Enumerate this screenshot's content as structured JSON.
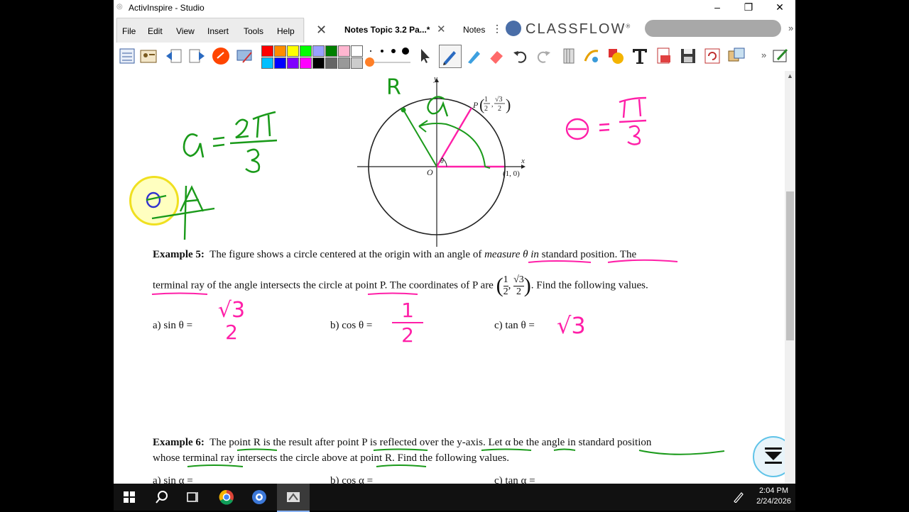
{
  "window": {
    "title": "ActivInspire - Studio"
  },
  "menu": {
    "file": "File",
    "edit": "Edit",
    "view": "View",
    "insert": "Insert",
    "tools": "Tools",
    "help": "Help"
  },
  "tabs": [
    {
      "label": "Notes Topic 3.2 Pa...*"
    },
    {
      "label": "Notes"
    }
  ],
  "classflow": {
    "brand": "CLASSFLOW",
    "mark": "®"
  },
  "palette": {
    "colors": [
      "#ff0000",
      "#ff8c00",
      "#ffff00",
      "#00ff00",
      "#008000",
      "#ffc0cb",
      "#ff80c0",
      "#ffffff",
      "#00bfff",
      "#0000ff",
      "#8000ff",
      "#ff00ff",
      "#000000",
      "#666666",
      "#999999",
      "#cccccc"
    ]
  },
  "page": {
    "top_handwriting": {
      "alpha_eq": "α = 2π/3",
      "theta_eq": "θ = π/3",
      "letter_r": "R"
    },
    "diagram": {
      "axis_y": "y",
      "axis_x": "x",
      "origin": "O",
      "point_p_label": "P",
      "point_p_x": "1",
      "point_p_x_den": "2",
      "point_p_y": "√3",
      "point_p_y_den": "2",
      "point_one": "(1, 0)",
      "theta": "θ"
    },
    "example5": {
      "label": "Example 5:",
      "line1a": "The figure shows a circle centered at the origin with an angle of ",
      "line1b": "measure θ in",
      "line1c": " ",
      "line1d": "standard position",
      "line1e": ".  The",
      "line2a": "terminal ray",
      "line2b": " of the angle intersects the circle ",
      "line2c": "at point P",
      "line2d": ".  The coordinates of P are",
      "coord_x_num": "1",
      "coord_x_den": "2",
      "coord_y_num": "√3",
      "coord_y_den": "2",
      "line2e": ".  Find the following values.",
      "qa": "a) sin θ =",
      "qb": "b) cos θ =",
      "qc": "c) tan θ ="
    },
    "answers": {
      "a_num": "√3",
      "a_den": "2",
      "b_num": "1",
      "b_den": "2",
      "c": "√3"
    },
    "example6": {
      "label": "Example 6:",
      "line1a": "The ",
      "line1b": "point R",
      "line1c": " is the result after point ",
      "line1d": "P is reflected",
      "line1e": " over ",
      "line1f": "the y-axis",
      "line1g": ".  Let ",
      "line1h": "α be",
      "line1i": " the angle in ",
      "line1j": "standard position",
      "line2a": "whose ",
      "line2b": "terminal ray",
      "line2c": " intersects the circle above ",
      "line2d": "at point R",
      "line2e": ".  Find the following values.",
      "qa": "a) sin α =",
      "qb": "b) cos α =",
      "qc": "c) tan α ="
    }
  },
  "taskbar": {
    "time": "2:04 PM",
    "date": "2/24/2026"
  }
}
